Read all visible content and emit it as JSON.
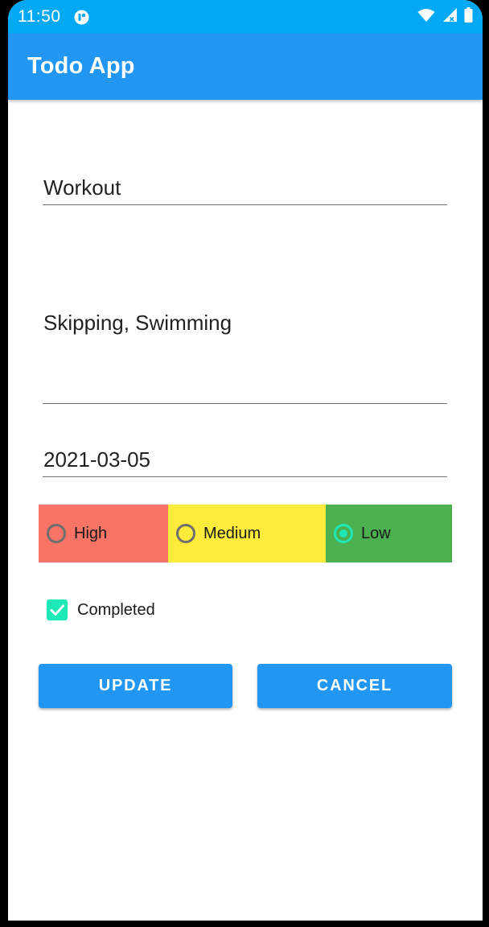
{
  "status_bar": {
    "time": "11:50",
    "icons": [
      "app-notification-icon",
      "wifi-icon",
      "signal-icon",
      "battery-icon"
    ],
    "color": "#03a9f4"
  },
  "app_bar": {
    "title": "Todo App",
    "color": "#2196f3"
  },
  "form": {
    "title_value": "Workout",
    "description_value": "Skipping, Swimming",
    "date_value": "2021-03-05",
    "priority": {
      "selected": "Low",
      "options": [
        {
          "label": "High",
          "color": "#f87467",
          "checked": false
        },
        {
          "label": "Medium",
          "color": "#ffeb3b",
          "checked": false
        },
        {
          "label": "Low",
          "color": "#4caf50",
          "checked": true
        }
      ]
    },
    "completed": {
      "label": "Completed",
      "checked": true,
      "accent": "#1de9b6"
    }
  },
  "buttons": {
    "update_label": "UPDATE",
    "cancel_label": "CANCEL"
  }
}
